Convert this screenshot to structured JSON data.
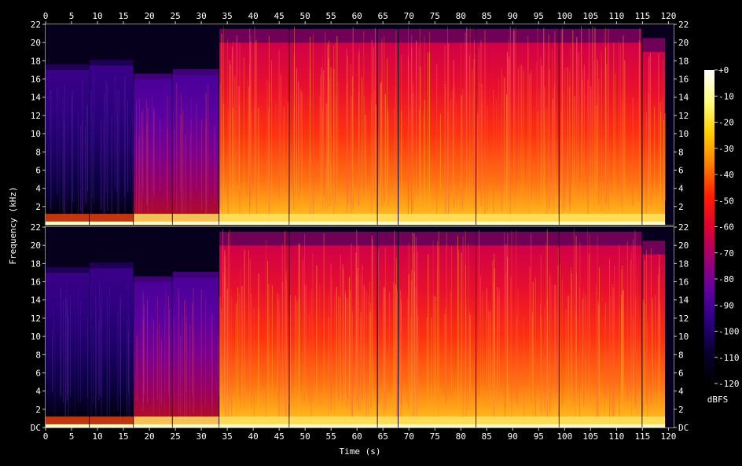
{
  "chart_data": {
    "type": "heatmap",
    "subtype": "spectrogram",
    "channels": 2,
    "xlabel": "Time (s)",
    "ylabel": "Frequency (kHz)",
    "x_range": [
      0,
      121
    ],
    "y_range": [
      0,
      22
    ],
    "x_ticks": [
      0,
      5,
      10,
      15,
      20,
      25,
      30,
      35,
      40,
      45,
      50,
      55,
      60,
      65,
      70,
      75,
      80,
      85,
      90,
      95,
      100,
      105,
      110,
      115,
      120
    ],
    "y_tick_labels_top": [
      "2",
      "4",
      "6",
      "8",
      "10",
      "12",
      "14",
      "16",
      "18",
      "20",
      "22"
    ],
    "y_tick_labels_bottom": [
      "DC",
      "2",
      "4",
      "6",
      "8",
      "10",
      "12",
      "14",
      "16",
      "18",
      "20",
      "22"
    ],
    "colorbar": {
      "label": "dBFS",
      "range": [
        -120,
        0
      ],
      "ticks": [
        "+0",
        "-10",
        "-20",
        "-30",
        "-40",
        "-50",
        "-60",
        "-70",
        "-80",
        "-90",
        "-100",
        "-110",
        "-120"
      ],
      "stops": [
        "#ffffff",
        "#ffff80",
        "#ffd000",
        "#ff8000",
        "#ff2000",
        "#e00030",
        "#a00070",
        "#6000a0",
        "#2a0080",
        "#080030",
        "#000000"
      ]
    },
    "segments": [
      {
        "start": 0,
        "end": 8.5,
        "level": "quiet",
        "max_khz": 17
      },
      {
        "start": 8.5,
        "end": 17,
        "level": "quiet",
        "max_khz": 17.5
      },
      {
        "start": 17,
        "end": 24.5,
        "level": "medium",
        "max_khz": 16
      },
      {
        "start": 24.5,
        "end": 33.5,
        "level": "medium",
        "max_khz": 16.5
      },
      {
        "start": 33.5,
        "end": 47,
        "level": "loud",
        "max_khz": 20
      },
      {
        "start": 47,
        "end": 64,
        "level": "loud",
        "max_khz": 20
      },
      {
        "start": 64,
        "end": 68,
        "level": "loud",
        "max_khz": 20
      },
      {
        "start": 68,
        "end": 83,
        "level": "loud",
        "max_khz": 20
      },
      {
        "start": 83,
        "end": 99,
        "level": "loud",
        "max_khz": 20
      },
      {
        "start": 99,
        "end": 115,
        "level": "loud",
        "max_khz": 20
      },
      {
        "start": 115,
        "end": 119.5,
        "level": "loud",
        "max_khz": 19
      }
    ]
  }
}
